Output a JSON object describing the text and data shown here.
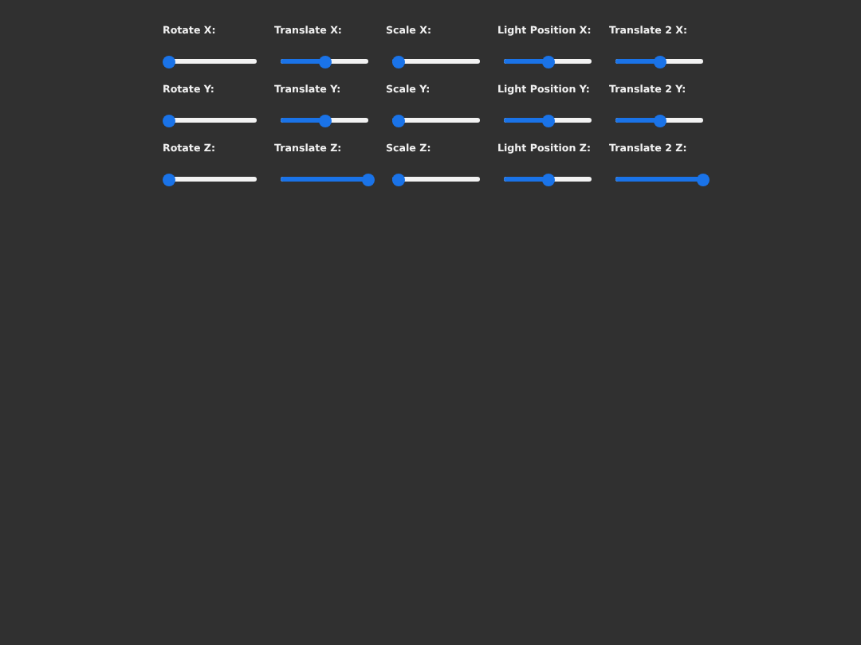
{
  "sliders": [
    {
      "label": "Rotate X:",
      "level": 0
    },
    {
      "label": "Translate X:",
      "level": 0.5
    },
    {
      "label": "Scale X:",
      "level": 0.08
    },
    {
      "label": "Light Position X:",
      "level": 0.5
    },
    {
      "label": "Translate 2 X:",
      "level": 0.5
    },
    {
      "label": "Rotate Y:",
      "level": 0
    },
    {
      "label": "Translate Y:",
      "level": 0.5
    },
    {
      "label": "Scale Y:",
      "level": 0.08
    },
    {
      "label": "Light Position Y:",
      "level": 0.5
    },
    {
      "label": "Translate 2 Y:",
      "level": 0.5
    },
    {
      "label": "Rotate Z:",
      "level": 0
    },
    {
      "label": "Translate Z:",
      "level": 1
    },
    {
      "label": "Scale Z:",
      "level": 0.08
    },
    {
      "label": "Light Position Z:",
      "level": 0.5
    },
    {
      "label": "Translate 2 Z:",
      "level": 1
    }
  ]
}
